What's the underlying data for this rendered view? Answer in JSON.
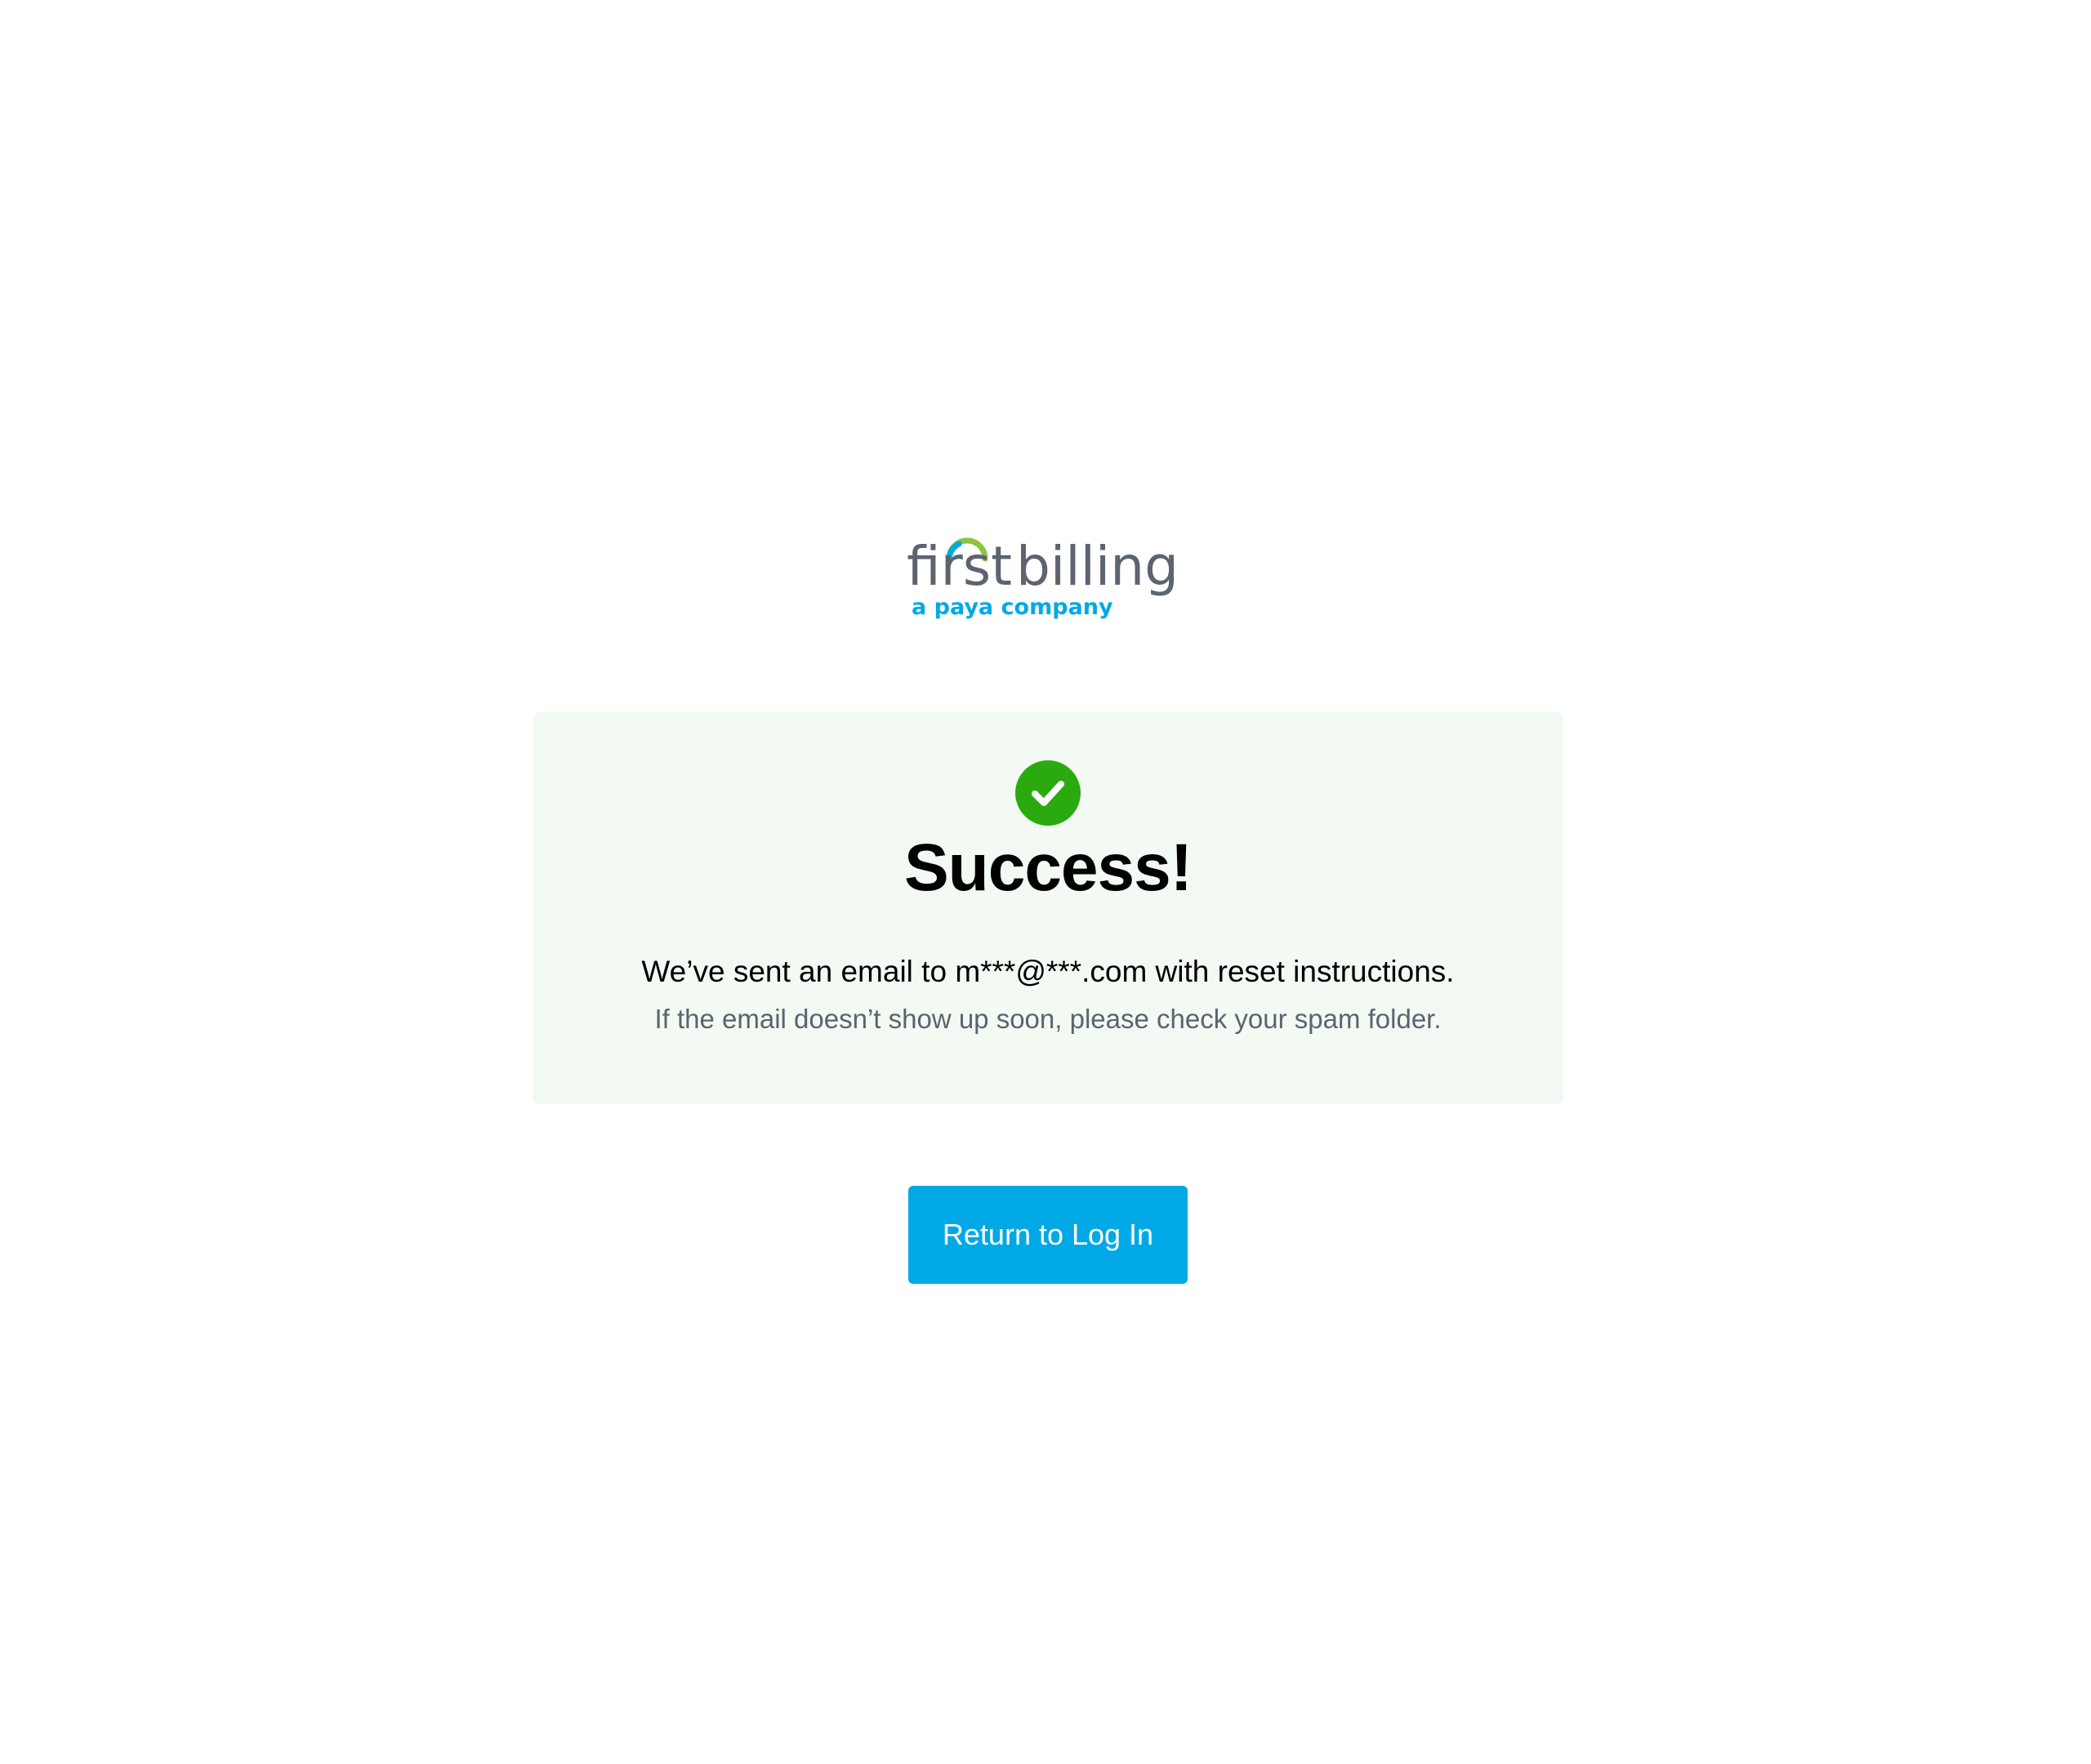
{
  "logo": {
    "brand_word_1": "first",
    "brand_word_2": "billing",
    "tagline": "a paya company",
    "colors": {
      "wordmark": "#5d6470",
      "tagline": "#00a9e6",
      "arc_green": "#8cc63f",
      "arc_blue": "#00a9e6"
    }
  },
  "card": {
    "icon": "check-circle-icon",
    "title": "Success!",
    "message": "We’ve sent an email to m***@***.com with reset instructions.",
    "hint": "If the email doesn’t show up soon, please check your spam folder.",
    "colors": {
      "background": "#f3faf3",
      "check": "#2aaa0f"
    }
  },
  "actions": {
    "return_label": "Return to Log In",
    "button_color": "#00a9e6"
  }
}
